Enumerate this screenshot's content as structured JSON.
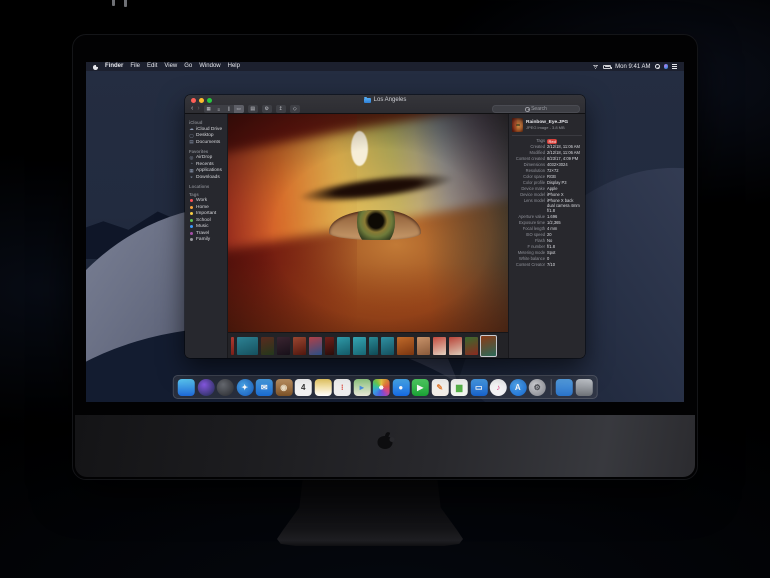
{
  "menu_bar": {
    "apple_icon": "apple-logo",
    "items": [
      "Finder",
      "File",
      "Edit",
      "View",
      "Go",
      "Window",
      "Help"
    ],
    "status": {
      "icons": [
        "wifi",
        "battery"
      ],
      "time": "Mon 9:41 AM",
      "right_icons": [
        "spotlight",
        "siri",
        "notification-center"
      ]
    }
  },
  "window": {
    "title": "Los Angeles",
    "controls": {
      "close": "#ff5f57",
      "minimize": "#febc2e",
      "zoom": "#28c840"
    },
    "toolbar": {
      "glyphs": {
        "back": "‹",
        "forward": "›",
        "icon_view": "▦",
        "list_view": "≡",
        "column_view": "∥",
        "gallery_view": "▭",
        "grouping": "▤",
        "action": "⚙",
        "share": "↥",
        "tags": "◇"
      },
      "selected_view": "gallery",
      "search_placeholder": "Search"
    },
    "sidebar": {
      "sections": [
        {
          "header": "iCloud",
          "items": [
            {
              "label": "iCloud Drive",
              "icon": "icloud-drive-icon",
              "glyph": "☁"
            },
            {
              "label": "Desktop",
              "icon": "desktop-icon",
              "glyph": "▢"
            },
            {
              "label": "Documents",
              "icon": "documents-icon",
              "glyph": "▤"
            }
          ]
        },
        {
          "header": "Favorites",
          "items": [
            {
              "label": "AirDrop",
              "icon": "airdrop-icon",
              "glyph": "◎"
            },
            {
              "label": "Recents",
              "icon": "recents-icon",
              "glyph": "◔"
            },
            {
              "label": "Applications",
              "icon": "applications-icon",
              "glyph": "▦"
            },
            {
              "label": "Downloads",
              "icon": "downloads-icon",
              "glyph": "◒"
            }
          ]
        },
        {
          "header": "Locations",
          "items": []
        },
        {
          "header": "Tags",
          "items": [
            {
              "label": "Work",
              "tag_color": "#ff5257"
            },
            {
              "label": "Home",
              "tag_color": "#f7a23b"
            },
            {
              "label": "Important",
              "tag_color": "#f7ce45"
            },
            {
              "label": "School",
              "tag_color": "#62c554"
            },
            {
              "label": "Music",
              "tag_color": "#3b99fc"
            },
            {
              "label": "Travel",
              "tag_color": "#a550a7"
            },
            {
              "label": "Family",
              "tag_color": "#9a9aa0"
            }
          ]
        }
      ]
    },
    "preview": {
      "filename": "Rainbow_Eye.JPG",
      "filetype": "JPEG image - 3.8 MB",
      "rows": [
        {
          "label": "Tags",
          "value": "Red",
          "tag_color": "#d6403a"
        },
        {
          "label": "Created",
          "value": "2/12/18, 11:06 AM"
        },
        {
          "label": "Modified",
          "value": "2/12/18, 11:06 AM"
        },
        {
          "label": "Content created",
          "value": "8/23/17, 4:09 PM"
        },
        {
          "label": "Dimensions",
          "value": "4032×3024"
        },
        {
          "label": "Resolution",
          "value": "72×72"
        },
        {
          "label": "Color space",
          "value": "RGB"
        },
        {
          "label": "Color profile",
          "value": "Display P3"
        },
        {
          "label": "Device make",
          "value": "Apple"
        },
        {
          "label": "Device model",
          "value": "iPhone X"
        },
        {
          "label": "Lens model",
          "value": "iPhone X back dual camera 4mm f/1.8"
        },
        {
          "label": "Aperture value",
          "value": "1.696"
        },
        {
          "label": "Exposure time",
          "value": "1/2,365"
        },
        {
          "label": "Focal length",
          "value": "4 mm"
        },
        {
          "label": "ISO speed",
          "value": "20"
        },
        {
          "label": "Flash",
          "value": "No"
        },
        {
          "label": "F number",
          "value": "f/1.8"
        },
        {
          "label": "Metering mode",
          "value": "Spot"
        },
        {
          "label": "White balance",
          "value": "0"
        },
        {
          "label": "Content Creator",
          "value": "7/10"
        }
      ]
    },
    "filmstrip": {
      "thumbnails": [
        {
          "w": 3,
          "c1": "#b03a30",
          "c2": "#7a1f18"
        },
        {
          "w": 21,
          "c1": "#2d8294",
          "c2": "#15505e"
        },
        {
          "w": 13,
          "c1": "#5a2a1e",
          "c2": "#23381c"
        },
        {
          "w": 13,
          "c1": "#3a2430",
          "c2": "#171019"
        },
        {
          "w": 13,
          "c1": "#9a4630",
          "c2": "#51170e"
        },
        {
          "w": 13,
          "c1": "#b04048",
          "c2": "#2a4f86"
        },
        {
          "w": 9,
          "c1": "#701f1a",
          "c2": "#2a0d0a"
        },
        {
          "w": 13,
          "c1": "#2f9aa8",
          "c2": "#135a68"
        },
        {
          "w": 13,
          "c1": "#35a5b2",
          "c2": "#176673"
        },
        {
          "w": 9,
          "c1": "#2a8a96",
          "c2": "#0f4a55"
        },
        {
          "w": 13,
          "c1": "#2f90a2",
          "c2": "#14505e"
        },
        {
          "w": 17,
          "c1": "#c06a2a",
          "c2": "#7a3510"
        },
        {
          "w": 13,
          "c1": "#c8936a",
          "c2": "#8a5a3a"
        },
        {
          "w": 13,
          "c1": "#c24a3e",
          "c2": "#e4d2c0"
        },
        {
          "w": 13,
          "c1": "#b84438",
          "c2": "#ddcbb8"
        },
        {
          "w": 13,
          "c1": "#3a6a2e",
          "c2": "#8a2a20"
        },
        {
          "w": 15,
          "c1": "#8a3a16",
          "c2": "#2a6a5a",
          "selected": true
        }
      ]
    }
  },
  "dock": {
    "items": [
      {
        "name": "finder",
        "type": "linear",
        "c1": "#5ac8f5",
        "c2": "#1e68d6",
        "glyph": ""
      },
      {
        "name": "siri",
        "type": "radial",
        "c1": "#8a5ae8",
        "c2": "#1c2a4a",
        "glyph": "",
        "shape": "circle"
      },
      {
        "name": "launchpad",
        "type": "radial",
        "c1": "#6a6d74",
        "c2": "#26282d",
        "glyph": "",
        "shape": "circle"
      },
      {
        "name": "safari",
        "type": "radial",
        "c1": "#4aa8f0",
        "c2": "#1658b8",
        "glyph": "✦",
        "gc": "#ffffff",
        "shape": "circle"
      },
      {
        "name": "mail",
        "type": "linear",
        "c1": "#4aa4ec",
        "c2": "#1a6ad0",
        "glyph": "✉",
        "gc": "#ffffff"
      },
      {
        "name": "contacts",
        "type": "linear",
        "c1": "#c89a68",
        "c2": "#7a5026",
        "glyph": "◉",
        "gc": "#f0e2c8"
      },
      {
        "name": "calendar",
        "type": "linear",
        "c1": "#ffffff",
        "c2": "#f0f0f0",
        "glyph": "4",
        "gc": "#333333"
      },
      {
        "name": "notes",
        "type": "linear",
        "c1": "#f6d56a",
        "c2": "#ffffff",
        "glyph": ""
      },
      {
        "name": "reminders",
        "type": "linear",
        "c1": "#ffffff",
        "c2": "#ececec",
        "glyph": "⁝",
        "gc": "#e0483e"
      },
      {
        "name": "maps",
        "type": "linear",
        "c1": "#9ad48a",
        "c2": "#e8e6d8",
        "glyph": "▸",
        "gc": "#4a90e2"
      },
      {
        "name": "photos",
        "type": "conic",
        "c1": "#ffffff",
        "c2": "#ffffff",
        "glyph": ""
      },
      {
        "name": "messages",
        "type": "linear",
        "c1": "#4ab0f8",
        "c2": "#1668e0",
        "glyph": "●",
        "gc": "#ffffff"
      },
      {
        "name": "facetime",
        "type": "linear",
        "c1": "#54d868",
        "c2": "#1aa034",
        "glyph": "▶",
        "gc": "#ffffff"
      },
      {
        "name": "pages",
        "type": "linear",
        "c1": "#ffffff",
        "c2": "#f2ede6",
        "glyph": "✎",
        "gc": "#e8833a"
      },
      {
        "name": "numbers",
        "type": "linear",
        "c1": "#ffffff",
        "c2": "#f0f4ee",
        "glyph": "▆",
        "gc": "#57b44a"
      },
      {
        "name": "keynote",
        "type": "linear",
        "c1": "#4aa2f0",
        "c2": "#1760c8",
        "glyph": "▭",
        "gc": "#ffffff"
      },
      {
        "name": "itunes",
        "type": "radial",
        "c1": "#ffffff",
        "c2": "#ededf2",
        "glyph": "♪",
        "gc": "#e8458a",
        "shape": "circle"
      },
      {
        "name": "app-store",
        "type": "radial",
        "c1": "#51a8f2",
        "c2": "#1565cc",
        "glyph": "A",
        "gc": "#ffffff",
        "shape": "circle"
      },
      {
        "name": "system-preferences",
        "type": "radial",
        "c1": "#d4d5da",
        "c2": "#7e8088",
        "glyph": "⚙",
        "gc": "#4a4c52",
        "shape": "circle"
      },
      {
        "name": "separator"
      },
      {
        "name": "downloads-folder",
        "type": "linear",
        "c1": "#58a6ec",
        "c2": "#2a72c8",
        "glyph": ""
      },
      {
        "name": "trash",
        "type": "linear",
        "c1": "#c2c6cc",
        "c2": "#6e7278",
        "glyph": ""
      }
    ]
  }
}
